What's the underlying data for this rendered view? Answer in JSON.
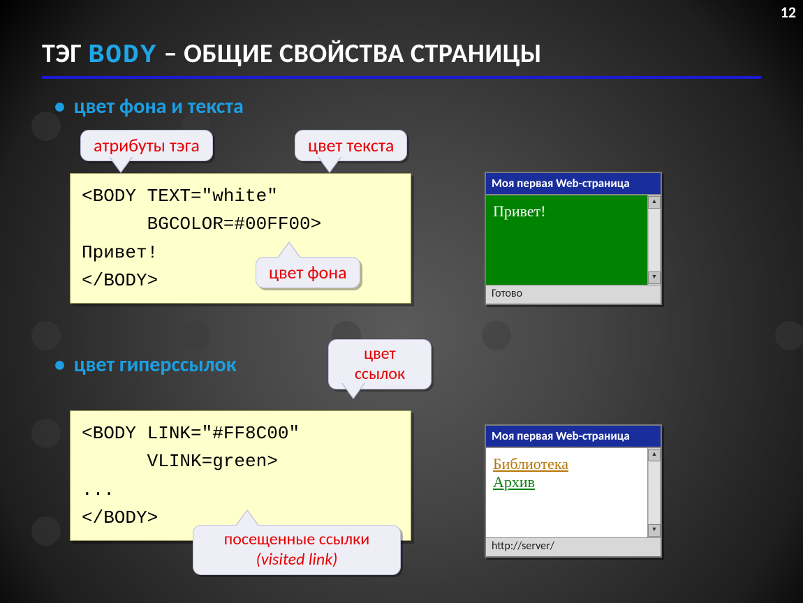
{
  "page_number": "12",
  "title": {
    "pre": "ТЭГ ",
    "body": "BODY",
    "post": " – ОБЩИЕ СВОЙСТВА СТРАНИЦЫ"
  },
  "bullets": {
    "b1": "цвет фона и текста",
    "b2": "цвет гиперссылок"
  },
  "callouts": {
    "attrs": "атрибуты тэга",
    "text_color": "цвет текста",
    "bg_color": "цвет фона",
    "link_color_l1": "цвет",
    "link_color_l2": "ссылок",
    "vlink_l1": "посещенные ссылки",
    "vlink_l2": "(visited link)"
  },
  "code1": "<BODY TEXT=\"white\"\n      BGCOLOR=#00FF00>\nПривет!\n</BODY>",
  "code2": "<BODY LINK=\"#FF8C00\"\n      VLINK=green>\n...\n</BODY>",
  "win": {
    "title": "Моя первая Web-страница",
    "status1": "Готово",
    "status2": "http://server/",
    "hello": "Привет!",
    "link1": "Библиотека",
    "link2": "Архив"
  }
}
